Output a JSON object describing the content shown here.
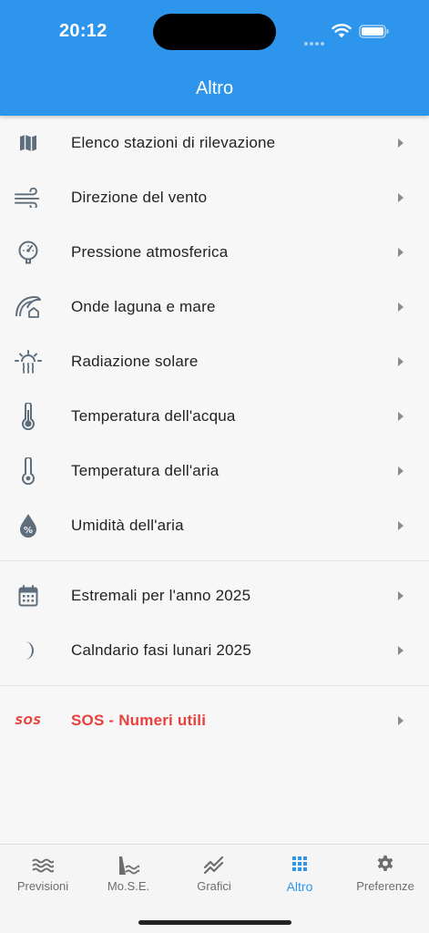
{
  "status": {
    "time": "20:12"
  },
  "header": {
    "title": "Altro"
  },
  "menu": {
    "group1": [
      {
        "label": "Elenco stazioni di rilevazione",
        "icon": "map-icon"
      },
      {
        "label": "Direzione del vento",
        "icon": "wind-icon"
      },
      {
        "label": "Pressione atmosferica",
        "icon": "gauge-icon"
      },
      {
        "label": "Onde laguna e mare",
        "icon": "wave-icon"
      },
      {
        "label": "Radiazione solare",
        "icon": "sun-heat-icon"
      },
      {
        "label": "Temperatura dell'acqua",
        "icon": "water-thermometer-icon"
      },
      {
        "label": "Temperatura dell'aria",
        "icon": "thermometer-icon"
      },
      {
        "label": "Umidità dell'aria",
        "icon": "humidity-drop-icon"
      }
    ],
    "group2": [
      {
        "label": "Estremali per l'anno 2025",
        "icon": "calendar-icon"
      },
      {
        "label": "Calndario fasi lunari 2025",
        "icon": "moon-icon"
      }
    ],
    "sos": {
      "label": "SOS - Numeri utili",
      "icon_text": "SOS"
    }
  },
  "tabs": [
    {
      "label": "Previsioni",
      "icon": "waves-icon",
      "active": false
    },
    {
      "label": "Mo.S.E.",
      "icon": "dam-icon",
      "active": false
    },
    {
      "label": "Grafici",
      "icon": "chart-line-icon",
      "active": false
    },
    {
      "label": "Altro",
      "icon": "grid-icon",
      "active": true
    },
    {
      "label": "Preferenze",
      "icon": "gear-icon",
      "active": false
    }
  ],
  "colors": {
    "accent": "#2e95ec",
    "icon": "#5e6e7c",
    "sos": "#e8403a",
    "tab_inactive": "#6d6d6d"
  }
}
